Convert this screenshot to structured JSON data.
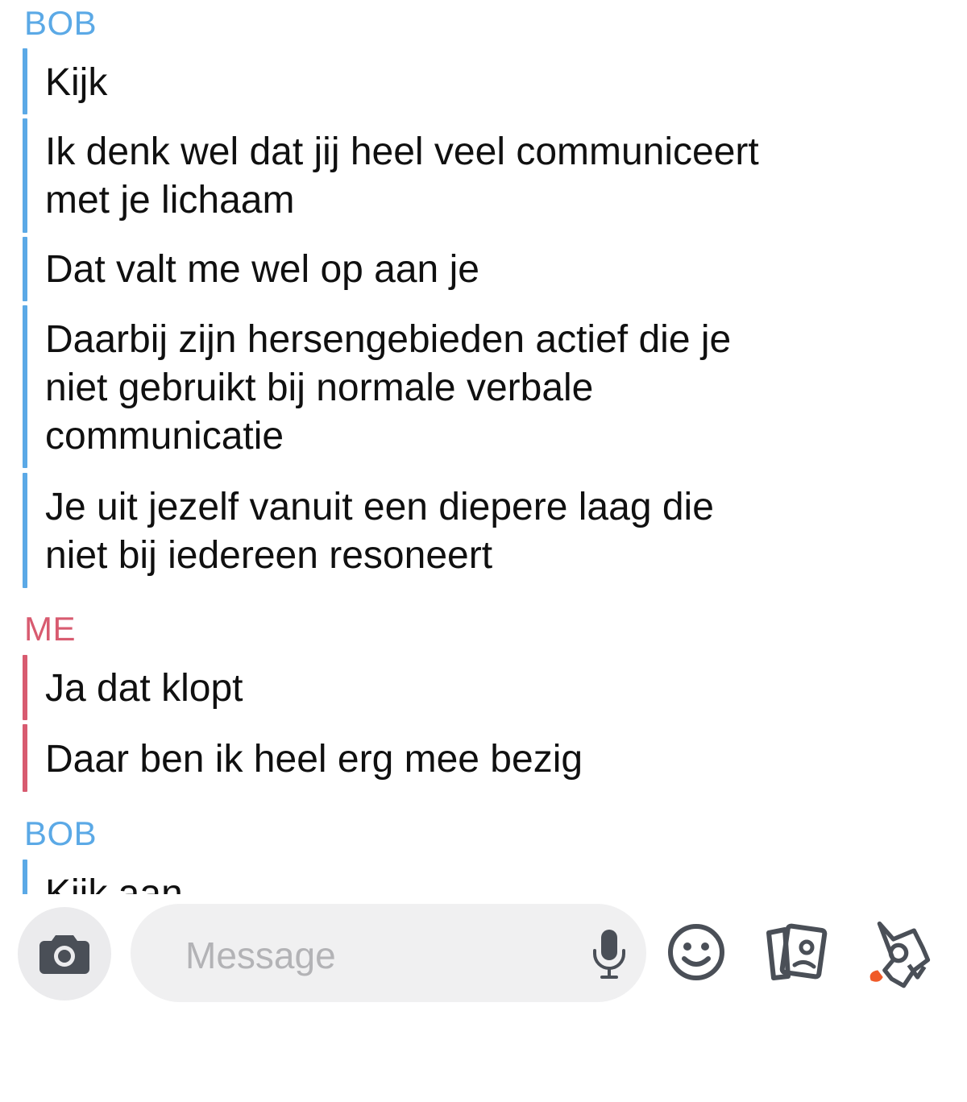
{
  "colors": {
    "bob": "#5ba9e6",
    "me": "#d85b70",
    "icon": "#4a4f57",
    "accent": "#f05a28"
  },
  "groups": [
    {
      "sender": "BOB",
      "messages": [
        "Kijk",
        "Ik denk wel dat jij heel veel communiceert\nmet je lichaam",
        "Dat valt me wel op aan je",
        "Daarbij zijn hersengebieden actief die je\nniet gebruikt bij normale verbale\ncommunicatie",
        "Je uit jezelf vanuit een diepere laag die\nniet bij iedereen resoneert"
      ]
    },
    {
      "sender": "ME",
      "messages": [
        "Ja dat klopt",
        "Daar ben ik heel erg mee bezig"
      ]
    },
    {
      "sender": "BOB",
      "messages": [
        "Kijk aan"
      ]
    }
  ],
  "composer": {
    "placeholder": "Message",
    "camera_icon": "camera-icon",
    "mic_icon": "microphone-icon",
    "emoji_icon": "emoji-icon",
    "stickers_icon": "stickers-icon",
    "rocket_icon": "rocket-icon"
  }
}
